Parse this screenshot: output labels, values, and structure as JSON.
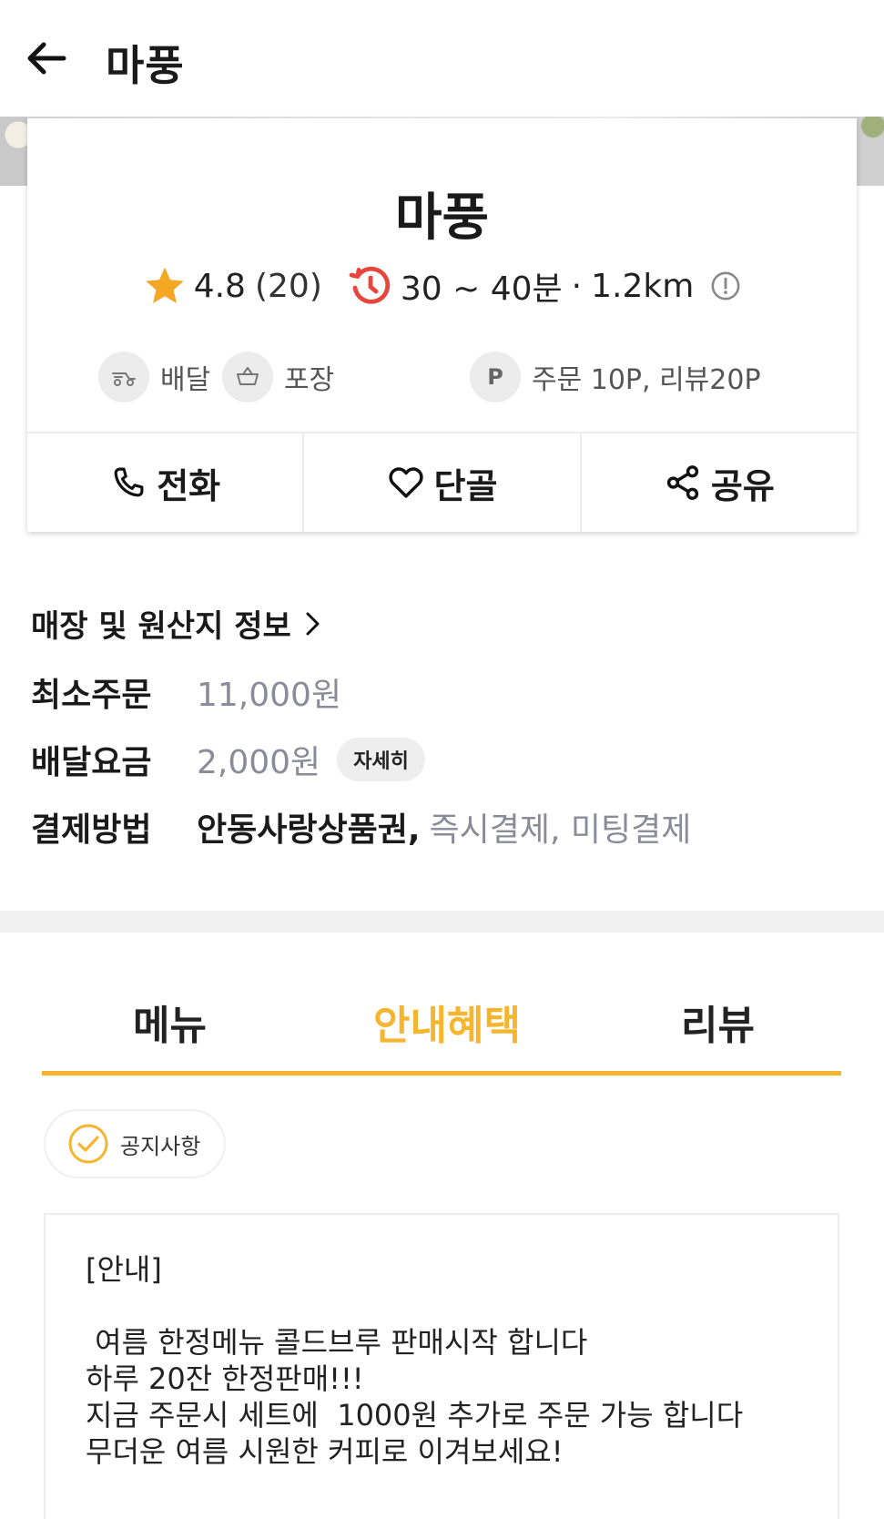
{
  "header": {
    "title": "마풍",
    "back_icon": "arrow-left-icon"
  },
  "store": {
    "name": "마풍",
    "rating": "4.8",
    "review_count": "(20)",
    "delivery_time": "30 ~ 40분",
    "separator": "·",
    "distance": "1.2km",
    "options": [
      {
        "label": "배달",
        "icon": "delivery-icon"
      },
      {
        "label": "포장",
        "icon": "basket-icon"
      },
      {
        "label": "주문 10P, 리뷰20P",
        "icon_text": "P"
      }
    ],
    "actions": [
      {
        "label": "전화",
        "icon": "phone-icon"
      },
      {
        "label": "단골",
        "icon": "heart-icon"
      },
      {
        "label": "공유",
        "icon": "share-icon"
      }
    ]
  },
  "info": {
    "store_info_link": "매장 및 원산지 정보",
    "min_order_label": "최소주문",
    "min_order_value": "11,000원",
    "delivery_fee_label": "배달요금",
    "delivery_fee_value": "2,000원",
    "detail_chip": "자세히",
    "payment_label": "결제방법",
    "payment_primary": "안동사랑상품권,",
    "payment_secondary": "즉시결제, 미팅결제"
  },
  "tabs": [
    {
      "label": "메뉴",
      "active": false
    },
    {
      "label": "안내혜택",
      "active": true
    },
    {
      "label": "리뷰",
      "active": false
    }
  ],
  "notice": {
    "chip_label": "공지사항",
    "lines": [
      "[안내]",
      "",
      " 여름 한정메뉴 콜드브루 판매시작 합니다",
      "하루 20잔 한정판매!!!",
      "지금 주문시 세트에  1000원 추가로 주문 가능 합니다",
      "무더운 여름 시원한 커피로 이겨보세요!"
    ]
  },
  "colors": {
    "accent": "#f5b52e",
    "star": "#f5a623",
    "clock": "#e8463c",
    "muted": "#8b8b99"
  }
}
